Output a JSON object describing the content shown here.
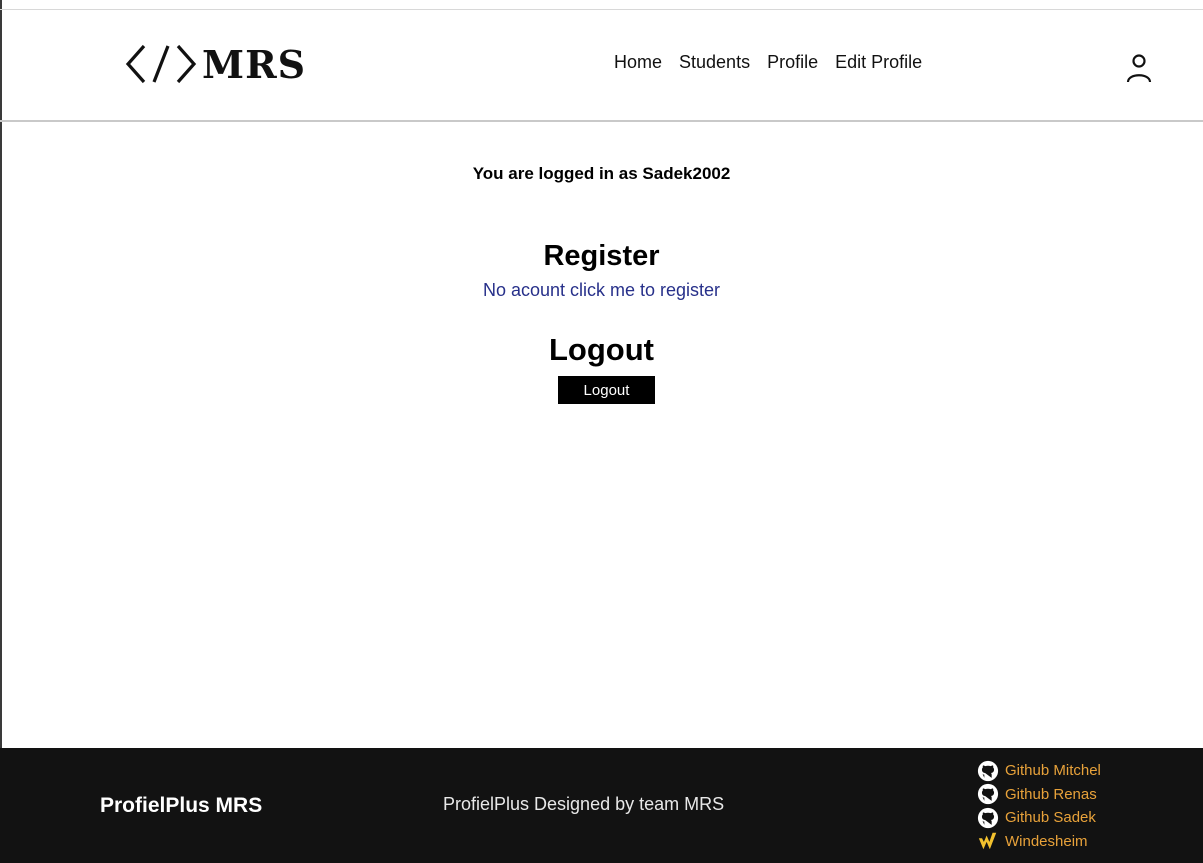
{
  "header": {
    "logo_text": "MRS",
    "nav": [
      {
        "label": "Home"
      },
      {
        "label": "Students"
      },
      {
        "label": "Profile"
      },
      {
        "label": "Edit Profile"
      }
    ],
    "user_icon": "user-icon"
  },
  "main": {
    "status_text": "You are logged in as Sadek2002",
    "register_title": "Register",
    "register_link": "No acount click me to register",
    "logout_title": "Logout",
    "logout_button": "Logout"
  },
  "footer": {
    "brand": "ProfielPlus MRS",
    "credit": "ProfielPlus Designed by team MRS",
    "links": [
      {
        "label": "Github Mitchel",
        "icon": "github-icon"
      },
      {
        "label": "Github Renas",
        "icon": "github-icon"
      },
      {
        "label": "Github Sadek",
        "icon": "github-icon"
      },
      {
        "label": "Windesheim",
        "icon": "windesheim-icon"
      }
    ],
    "link_color": "#e8a23a"
  }
}
